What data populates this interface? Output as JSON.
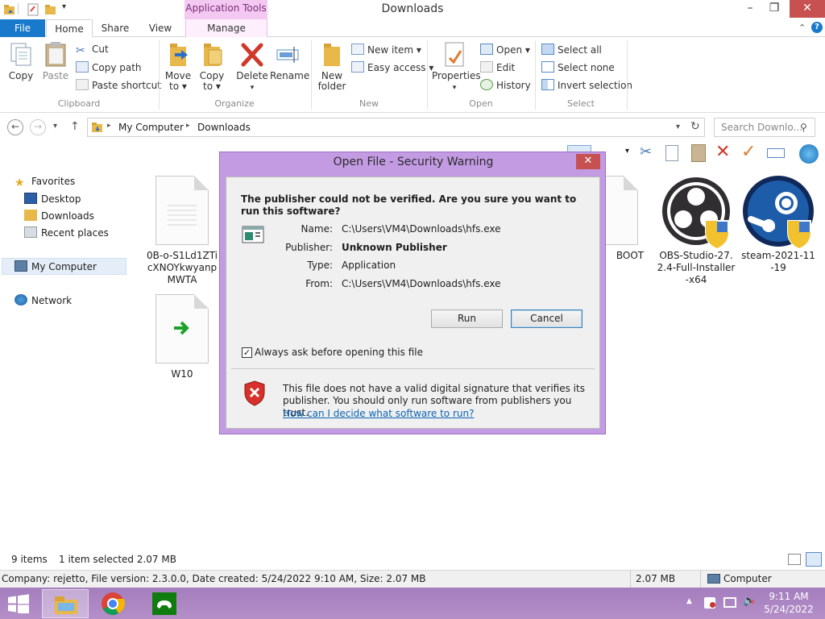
{
  "window": {
    "title": "Downloads",
    "context_tab_title": "Application Tools",
    "min_label": "–",
    "max_label": "❐",
    "close_label": "✕"
  },
  "tabs": {
    "file": "File",
    "home": "Home",
    "share": "Share",
    "view": "View",
    "manage": "Manage"
  },
  "ribbon": {
    "clipboard": {
      "label": "Clipboard",
      "copy": "Copy",
      "paste": "Paste",
      "cut": "Cut",
      "copy_path": "Copy path",
      "paste_shortcut": "Paste shortcut"
    },
    "organize": {
      "label": "Organize",
      "move_to_1": "Move",
      "move_to_2": "to ▾",
      "copy_to_1": "Copy",
      "copy_to_2": "to ▾",
      "delete": "Delete",
      "delete_arrow": "▾",
      "rename": "Rename"
    },
    "new": {
      "label": "New",
      "new_folder_1": "New",
      "new_folder_2": "folder",
      "new_item": "New item ▾",
      "easy_access": "Easy access ▾"
    },
    "open": {
      "label": "Open",
      "properties": "Properties",
      "properties_arrow": "▾",
      "open": "Open ▾",
      "edit": "Edit",
      "history": "History"
    },
    "select": {
      "label": "Select",
      "select_all": "Select all",
      "select_none": "Select none",
      "invert": "Invert selection"
    }
  },
  "address": {
    "back": "←",
    "forward": "→",
    "recent": "▾",
    "up": "↑",
    "crumbs": [
      "My Computer",
      "Downloads"
    ],
    "sep": "▸",
    "dropdown": "▾",
    "refresh": "↻",
    "search_placeholder": "Search Downlo..."
  },
  "nav": {
    "favorites": "Favorites",
    "desktop": "Desktop",
    "downloads": "Downloads",
    "recent": "Recent places",
    "computer": "My Computer",
    "network": "Network"
  },
  "files": {
    "f1": "0B-o-S1Ld1ZTicXNOYkwyanpMWTA",
    "f2": "W10",
    "f3": "BOOT",
    "f4": "OBS-Studio-27.2.4-Full-Installer-x64",
    "f5": "steam-2021-11-19"
  },
  "status": {
    "items": "9 items",
    "selected": "1 item selected  2.07 MB"
  },
  "details": {
    "info": "Company: rejetto, File version: 2.3.0.0, Date created: 5/24/2022 9:10 AM, Size: 2.07 MB",
    "size": "2.07 MB",
    "location": "Computer"
  },
  "taskbar": {
    "time": "9:11 AM",
    "date": "5/24/2022"
  },
  "dialog": {
    "title": "Open File - Security Warning",
    "close": "✕",
    "question": "The publisher could not be verified.  Are you sure you want to run this software?",
    "name_label": "Name:",
    "name_value": "C:\\Users\\VM4\\Downloads\\hfs.exe",
    "publisher_label": "Publisher:",
    "publisher_value": "Unknown Publisher",
    "type_label": "Type:",
    "type_value": "Application",
    "from_label": "From:",
    "from_value": "C:\\Users\\VM4\\Downloads\\hfs.exe",
    "run": "Run",
    "cancel": "Cancel",
    "checkbox_label": "Always ask before opening this file",
    "checkbox_checked": true,
    "warning_text": "This file does not have a valid digital signature that verifies its publisher.  You should only run software from publishers you trust.",
    "help_link": "How can I decide what software to run?"
  }
}
